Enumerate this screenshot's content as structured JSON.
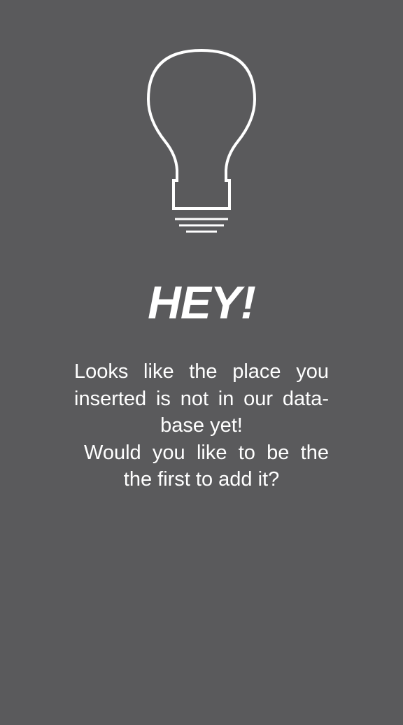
{
  "screen": {
    "background_color": "#5a5a5c",
    "icon": "lightbulb-icon",
    "title": "HEY!",
    "message_lines": [
      "Looks like the place you",
      "inserted is not in our data-",
      "base yet!",
      "Would you like to be the",
      "the first to add it?"
    ]
  }
}
